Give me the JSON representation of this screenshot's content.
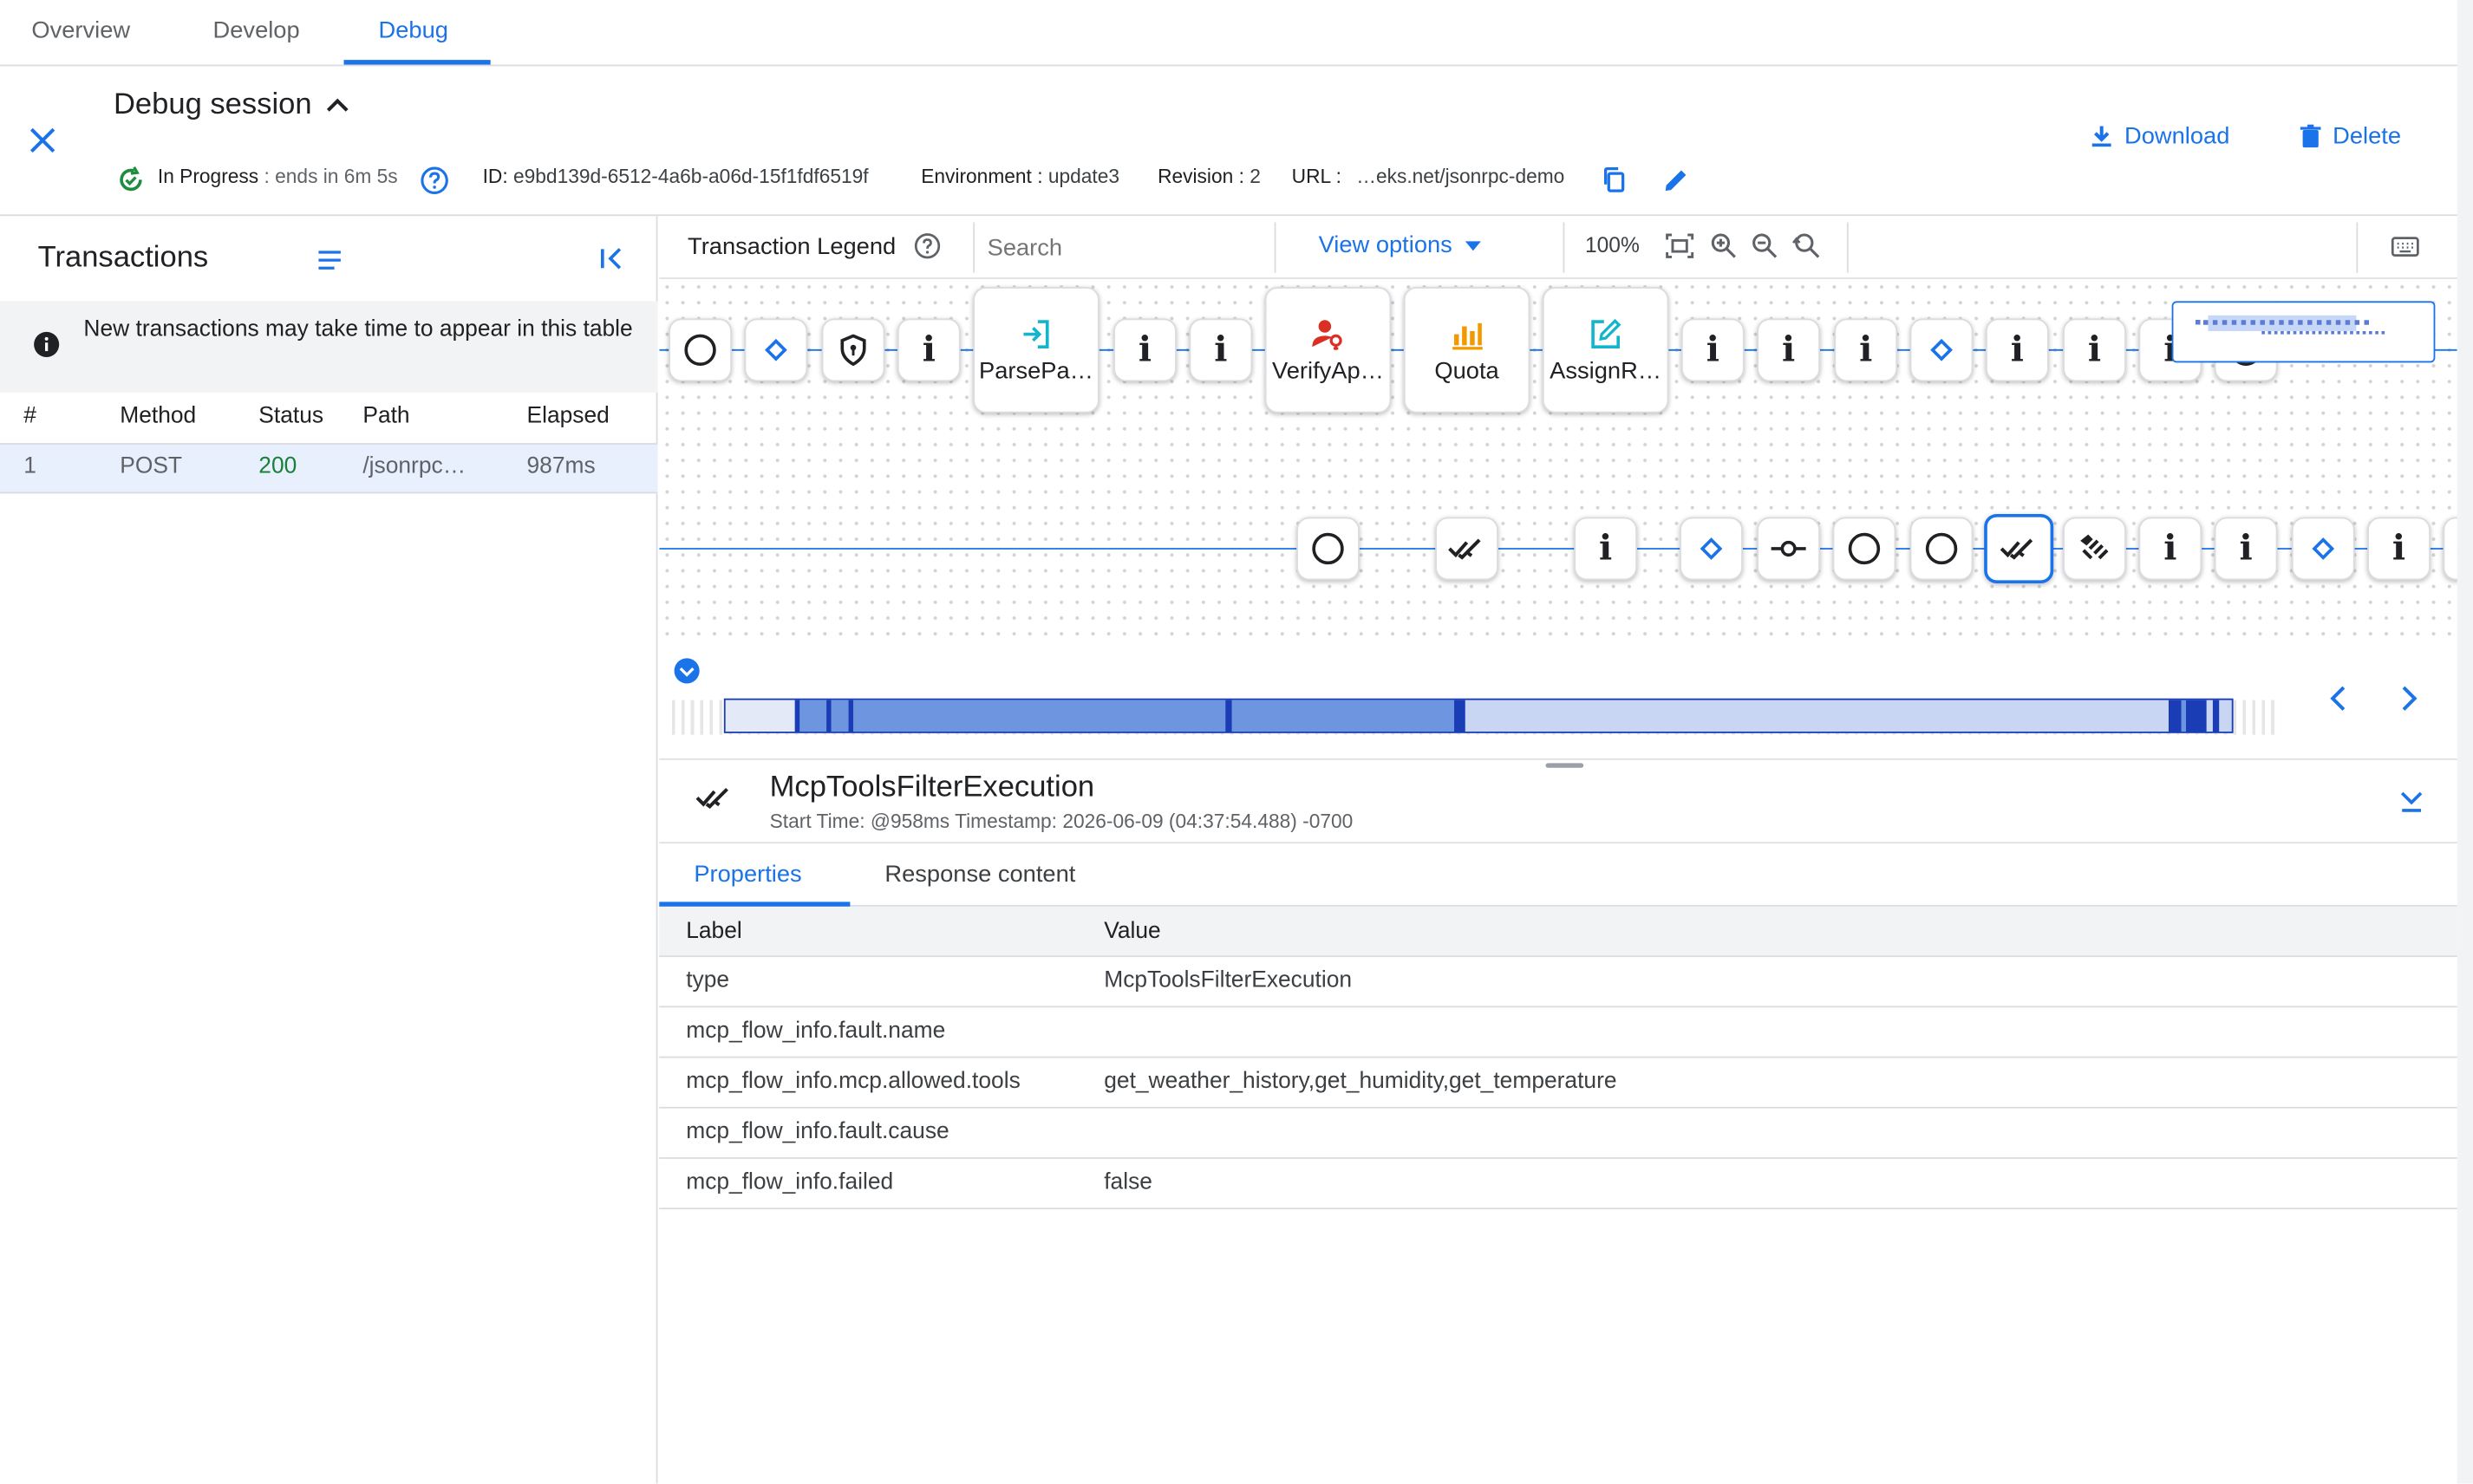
{
  "tabs": [
    "Overview",
    "Develop",
    "Debug"
  ],
  "session": {
    "title": "Debug session",
    "status": "In Progress",
    "status_suffix": ": ends in 6m 5s",
    "id_label": "ID:",
    "id_value": "e9bd139d-6512-4a6b-a06d-15f1fdf6519f",
    "env_label": "Environment :",
    "env_value": "update3",
    "rev_label": "Revision :",
    "rev_value": "2",
    "url_label": "URL :",
    "url_value": "…eks.net/jsonrpc-demo"
  },
  "actions": {
    "download": "Download",
    "delete": "Delete"
  },
  "transactions": {
    "title": "Transactions",
    "notice": "New transactions may take time to appear in this table",
    "columns": [
      "#",
      "Method",
      "Status",
      "Path",
      "Elapsed"
    ],
    "rows": [
      {
        "num": "1",
        "method": "POST",
        "status": "200",
        "path": "/jsonrpc…",
        "elapsed": "987ms"
      }
    ]
  },
  "toolbar": {
    "legend": "Transaction Legend",
    "search_placeholder": "Search",
    "view_options": "View options",
    "zoom": "100%"
  },
  "flow": {
    "top_row": [
      "start",
      "condition",
      "security",
      "info",
      "ParsePa…",
      "info",
      "info",
      "VerifyAp…",
      "Quota",
      "AssignR…",
      "info",
      "info",
      "info",
      "condition",
      "info",
      "info",
      "info"
    ],
    "bottom_row": [
      "start",
      "double-check",
      "info",
      "condition",
      "commit",
      "start",
      "start",
      "double-check",
      "mcp",
      "info",
      "info",
      "condition",
      "info"
    ],
    "labels": {
      "parse": "ParsePa…",
      "verify": "VerifyAp…",
      "quota": "Quota",
      "assign": "AssignR…"
    }
  },
  "detail": {
    "title": "McpToolsFilterExecution",
    "subtitle": "Start Time: @958ms Timestamp: 2026-06-09 (04:37:54.488) -0700",
    "tabs": [
      "Properties",
      "Response content"
    ],
    "columns": [
      "Label",
      "Value"
    ],
    "rows": [
      {
        "label": "type",
        "value": "McpToolsFilterExecution"
      },
      {
        "label": "mcp_flow_info.fault.name",
        "value": ""
      },
      {
        "label": "mcp_flow_info.mcp.allowed.tools",
        "value": "get_weather_history,get_humidity,get_temperature"
      },
      {
        "label": "mcp_flow_info.fault.cause",
        "value": ""
      },
      {
        "label": "mcp_flow_info.failed",
        "value": "false"
      }
    ]
  },
  "colors": {
    "accent": "#1a73e8",
    "success": "#188038",
    "in_progress": "#1e8e3e"
  }
}
